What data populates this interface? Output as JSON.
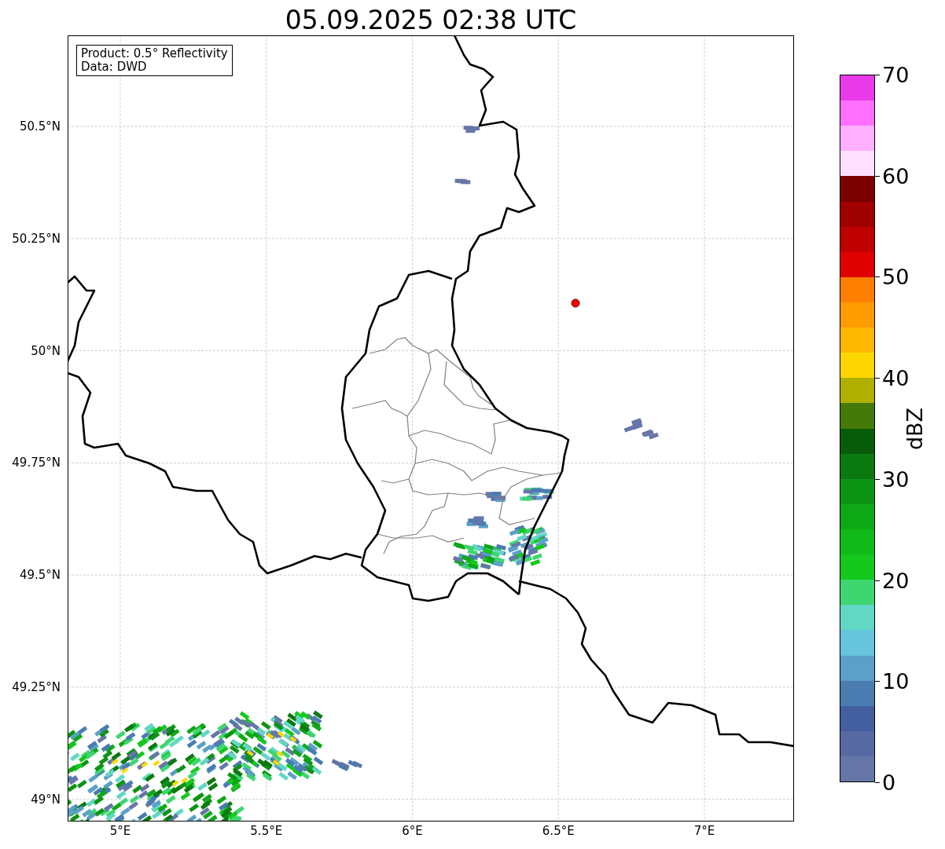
{
  "title": "05.09.2025 02:38 UTC",
  "info_box": {
    "lines": [
      "Product: 0.5° Reflectivity",
      "Data: DWD"
    ]
  },
  "map": {
    "x_ticks": [
      "5°E",
      "5.5°E",
      "6°E",
      "6.5°E",
      "7°E"
    ],
    "y_ticks": [
      "50.5°N",
      "50.25°N",
      "50°N",
      "49.75°N",
      "49.5°N",
      "49.25°N",
      "49°N"
    ]
  },
  "colorbar": {
    "label": "dBZ",
    "ticks": [
      "70",
      "60",
      "50",
      "40",
      "30",
      "20",
      "10",
      "0"
    ],
    "bins": [
      {
        "color": "#e83ae8"
      },
      {
        "color": "#ff70ff"
      },
      {
        "color": "#ffb0ff"
      },
      {
        "color": "#ffe0ff"
      },
      {
        "color": "#7a0000"
      },
      {
        "color": "#a00000"
      },
      {
        "color": "#c00000"
      },
      {
        "color": "#e00000"
      },
      {
        "color": "#ff7f00"
      },
      {
        "color": "#ff9c00"
      },
      {
        "color": "#ffb800"
      },
      {
        "color": "#ffd700"
      },
      {
        "color": "#b0b000"
      },
      {
        "color": "#457a08"
      },
      {
        "color": "#065c08"
      },
      {
        "color": "#0a7a10"
      },
      {
        "color": "#0c9414"
      },
      {
        "color": "#0ea816"
      },
      {
        "color": "#10ba18"
      },
      {
        "color": "#14c81c"
      },
      {
        "color": "#3ed670"
      },
      {
        "color": "#62d8c4"
      },
      {
        "color": "#66c4dc"
      },
      {
        "color": "#5aa0c8"
      },
      {
        "color": "#4a7cb2"
      },
      {
        "color": "#435fa0"
      },
      {
        "color": "#5669a2"
      },
      {
        "color": "#6676a8"
      }
    ]
  }
}
